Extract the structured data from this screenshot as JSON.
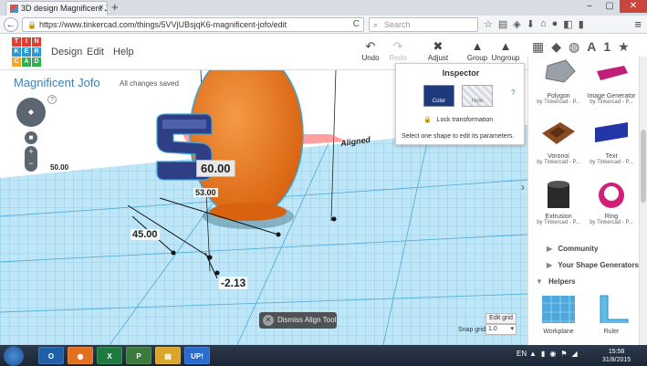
{
  "browser": {
    "tab_title": "3D design Magnificent Jof...",
    "tab_close": "×",
    "new_tab": "+",
    "win_min": "–",
    "win_max": "▢",
    "win_close": "✕",
    "back": "←",
    "url": "https://www.tinkercad.com/things/5VVjUBsjqK6-magnificent-jofo/edit",
    "reload": "C",
    "search_placeholder": "Search",
    "icons": [
      "star-icon",
      "bookmark-list-icon",
      "pocket-icon",
      "download-icon",
      "home-icon",
      "chat-icon",
      "ext-icon",
      "ext2-icon"
    ],
    "menu": "≡"
  },
  "header": {
    "logo_letters": [
      "T",
      "I",
      "N",
      "K",
      "E",
      "R",
      "C",
      "A",
      "D"
    ],
    "logo_colors": [
      "#e23d2e",
      "#e23d2e",
      "#e23d2e",
      "#2d9ad8",
      "#2d9ad8",
      "#2d9ad8",
      "#f5a623",
      "#2bb24c",
      "#2bb24c"
    ],
    "menu": {
      "design": "Design",
      "edit": "Edit",
      "help": "Help"
    },
    "tools": {
      "undo": "Undo",
      "redo": "Redo",
      "adjust": "Adjust",
      "group": "Group",
      "ungroup": "Ungroup"
    }
  },
  "workplane": {
    "title": "Magnificent Jofo",
    "save_status": "All changes saved",
    "help": "?",
    "view_cube_label": "◆",
    "zoom_plus": "+",
    "zoom_minus": "−",
    "dims": {
      "height": "60.00",
      "width": "53.00",
      "length": "50.00",
      "depth": "45.00",
      "elevation": "-2.13"
    },
    "aligned_label": "Aligned",
    "dismiss": "Dismiss Align Tool",
    "edit_grid": "Edit grid",
    "snap_label": "Snap grid",
    "snap_value": "1.0",
    "colors": {
      "grid": "#6fc4ea",
      "egg": "#f07a20",
      "letter": "#2f3f86",
      "accent": "#3e7fb0"
    }
  },
  "inspector": {
    "title": "Inspector",
    "color_label": "Color",
    "hole_label": "Hole",
    "help": "?",
    "lock_label": "Lock transformation",
    "message": "Select one shape to edit its parameters."
  },
  "shapes": {
    "cards": [
      {
        "name": "Polygon",
        "by": "by Tinkercad - P..."
      },
      {
        "name": "Image Generator",
        "by": "by Tinkercad - P..."
      },
      {
        "name": "Voronoi",
        "by": "by Tinkercad - P..."
      },
      {
        "name": "Text",
        "by": "by Tinkercad - P..."
      },
      {
        "name": "Extrusion",
        "by": "by Tinkercad - P..."
      },
      {
        "name": "Ring",
        "by": "by Tinkercad - P..."
      }
    ],
    "sections": {
      "community": "Community",
      "generators": "Your Shape Generators",
      "helpers": "Helpers"
    },
    "helpers": [
      {
        "name": "Workplane"
      },
      {
        "name": "Ruler"
      }
    ],
    "tab_letter": "A",
    "tab_number": "1"
  },
  "taskbar": {
    "apps": [
      "Outlook",
      "Firefox",
      "Excel",
      "Project",
      "Explorer",
      "UP!"
    ],
    "app_glyphs": [
      "O",
      "◉",
      "X",
      "P",
      "▤",
      "UP!"
    ],
    "app_colors": [
      "#1f5fa8",
      "#e0701f",
      "#1e7a3e",
      "#3a7a3a",
      "#d9a52a",
      "#2a6bd1"
    ],
    "lang": "EN",
    "time": "15:58",
    "date": "31/8/2015"
  }
}
